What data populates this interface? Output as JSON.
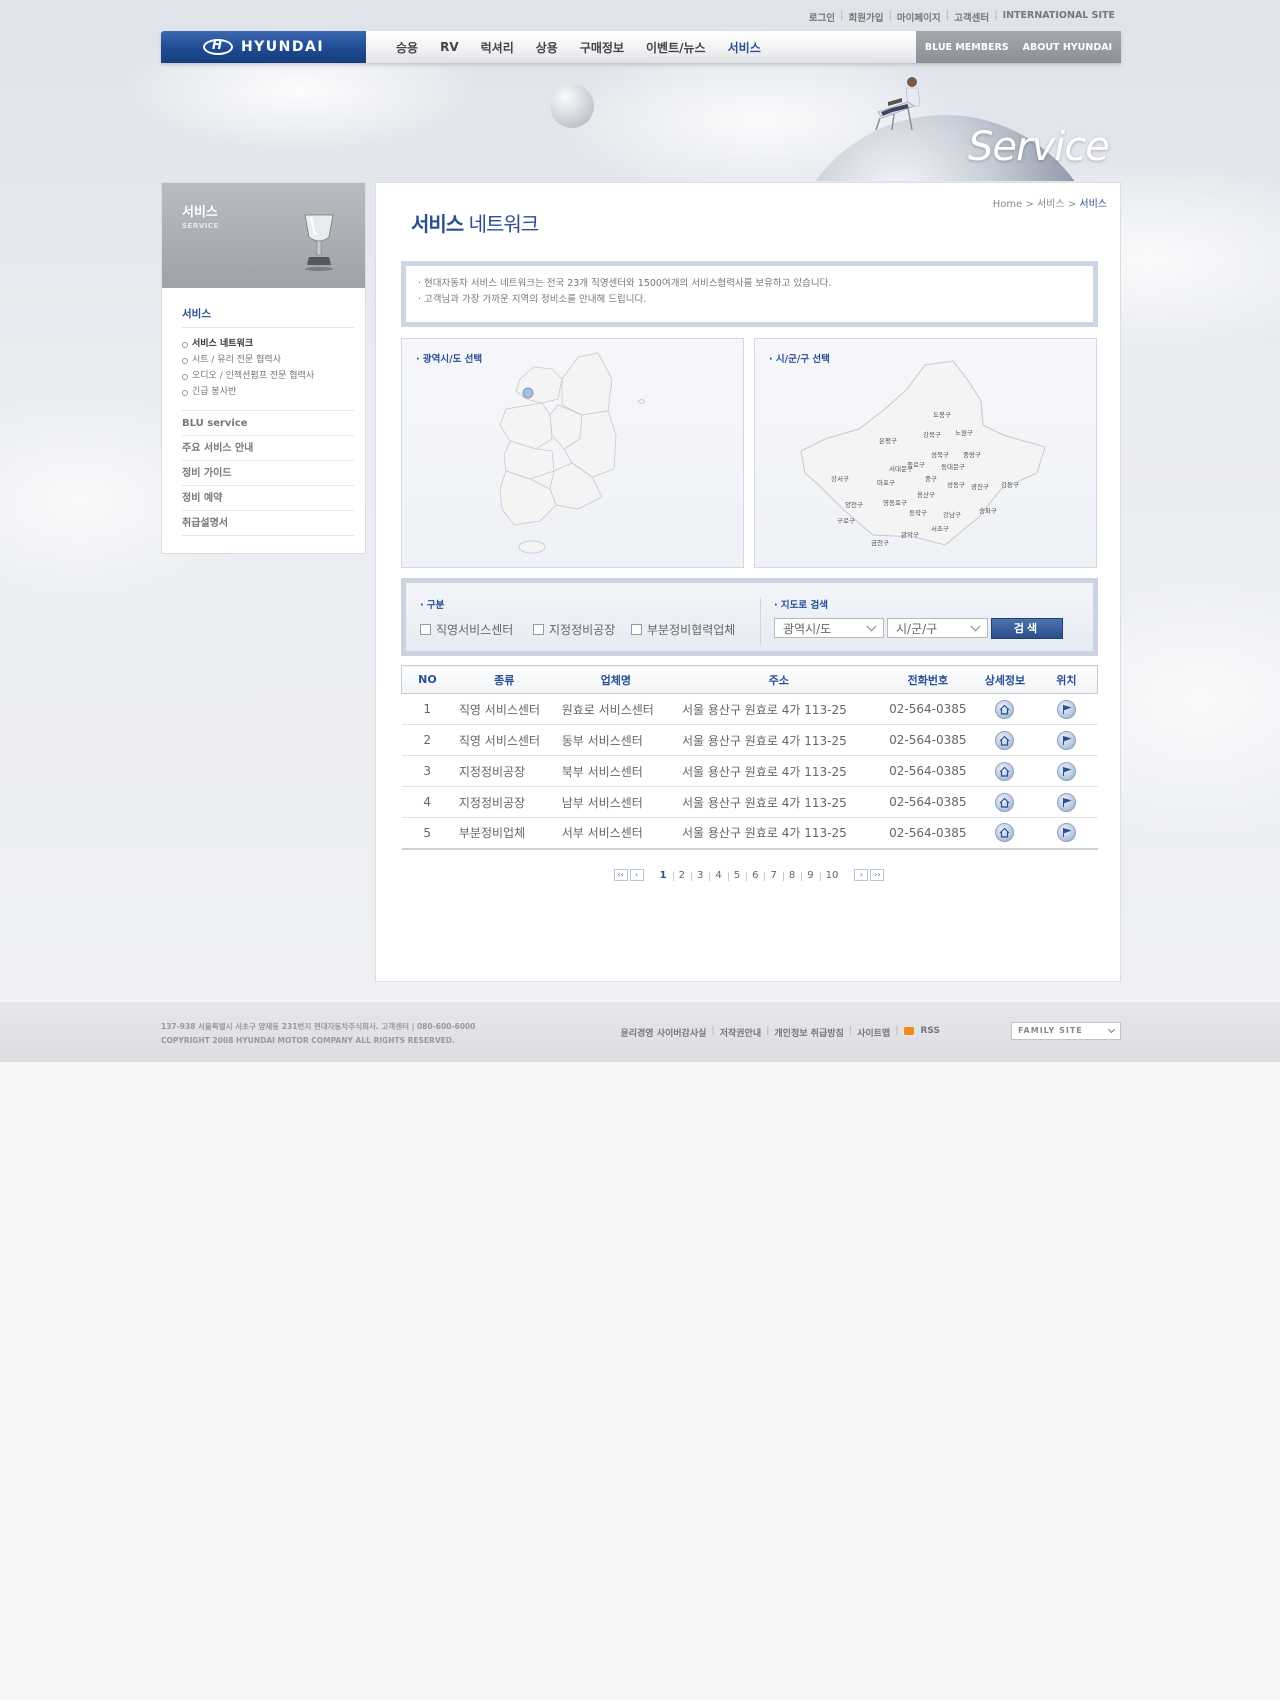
{
  "util_links": [
    "로그인",
    "회원가입",
    "마이페이지",
    "고객센터",
    "INTERNATIONAL SITE"
  ],
  "brand": "HYUNDAI",
  "gnb": {
    "menu": [
      "승용",
      "RV",
      "럭셔리",
      "상용",
      "구매정보",
      "이벤트/뉴스",
      "서비스"
    ],
    "active": "서비스",
    "right": [
      "BLUE MEMBERS",
      "ABOUT HYUNDAI"
    ]
  },
  "hero_title": "Service",
  "lnb": {
    "title": "서비스",
    "subtitle": "SERVICE",
    "category": "서비스",
    "sub_items": [
      "서비스 네트워크",
      "시트 / 유리 전문 협력사",
      "오디오 / 인젝션펌프 전문 협력사",
      "긴급 봉사반"
    ],
    "items": [
      "BLU service",
      "주요 서비스 안내",
      "정비 가이드",
      "정비 예약",
      "취급설명서"
    ]
  },
  "breadcrumb": [
    "Home",
    "서비스",
    "서비스"
  ],
  "page_title": {
    "strong": "서비스",
    "rest": "네트워크"
  },
  "notice": [
    "현대자동차 서비스 네트워크는 전국 23개 직영센터와 1500여개의 서비스협력사를 보유하고 있습니다.",
    "고객님과 가장 가까운 지역의 정비소를 안내해 드립니다."
  ],
  "maps": {
    "province_label": "광역시/도 선택",
    "district_label": "시/군/구 선택",
    "districts": [
      "도봉구",
      "강북구",
      "노원구",
      "은평구",
      "성북구",
      "중랑구",
      "종로구",
      "동대문구",
      "서대문구",
      "중구",
      "강서구",
      "마포구",
      "성동구",
      "광진구",
      "강동구",
      "용산구",
      "양천구",
      "영등포구",
      "동작구",
      "강남구",
      "송파구",
      "구로구",
      "서초구",
      "관악구",
      "금천구"
    ]
  },
  "search": {
    "type_label": "구분",
    "types": [
      "직영서비스센터",
      "지정정비공장",
      "부분정비협력업체"
    ],
    "map_label": "지도로 검색",
    "select1": "광역시/도",
    "select2": "시/군/구",
    "button": "검색"
  },
  "table": {
    "headers": [
      "NO",
      "종류",
      "업체명",
      "주소",
      "전화번호",
      "상세정보",
      "위치"
    ],
    "rows": [
      {
        "no": "1",
        "type": "직영 서비스센터",
        "name": "원효로 서비스센터",
        "addr": "서울 용산구 원효로 4가 113-25",
        "tel": "02-564-0385"
      },
      {
        "no": "2",
        "type": "직영 서비스센터",
        "name": "동부 서비스센터",
        "addr": "서울 용산구 원효로 4가 113-25",
        "tel": "02-564-0385"
      },
      {
        "no": "3",
        "type": "지정정비공장",
        "name": "북부 서비스센터",
        "addr": "서울 용산구 원효로 4가 113-25",
        "tel": "02-564-0385"
      },
      {
        "no": "4",
        "type": "지정정비공장",
        "name": "남부 서비스센터",
        "addr": "서울 용산구 원효로 4가 113-25",
        "tel": "02-564-0385"
      },
      {
        "no": "5",
        "type": "부분정비업체",
        "name": "서부 서비스센터",
        "addr": "서울 용산구 원효로 4가 113-25",
        "tel": "02-564-0385"
      }
    ]
  },
  "paging": {
    "pages": [
      "1",
      "2",
      "3",
      "4",
      "5",
      "6",
      "7",
      "8",
      "9",
      "10"
    ],
    "current": "1",
    "first": "‹‹",
    "prev": "‹",
    "next": "›",
    "last": "››"
  },
  "footer": {
    "address": "137-938 서울특별시 서초구 양재동 231번지 현대자동차주식회사.  고객센터  |  080-600-6000",
    "copyright": "COPYRIGHT  2008 HYUNDAI MOTOR COMPANY ALL RIGHTS RESERVED.",
    "links": [
      "윤리경영 사이버감사실",
      "저작권안내",
      "개인정보 취급방침",
      "사이트맵",
      "RSS"
    ],
    "family_site": "FAMILY SITE"
  },
  "colors": {
    "brand_blue": "#2a4f95",
    "nav_blue": "#1f4b93"
  }
}
